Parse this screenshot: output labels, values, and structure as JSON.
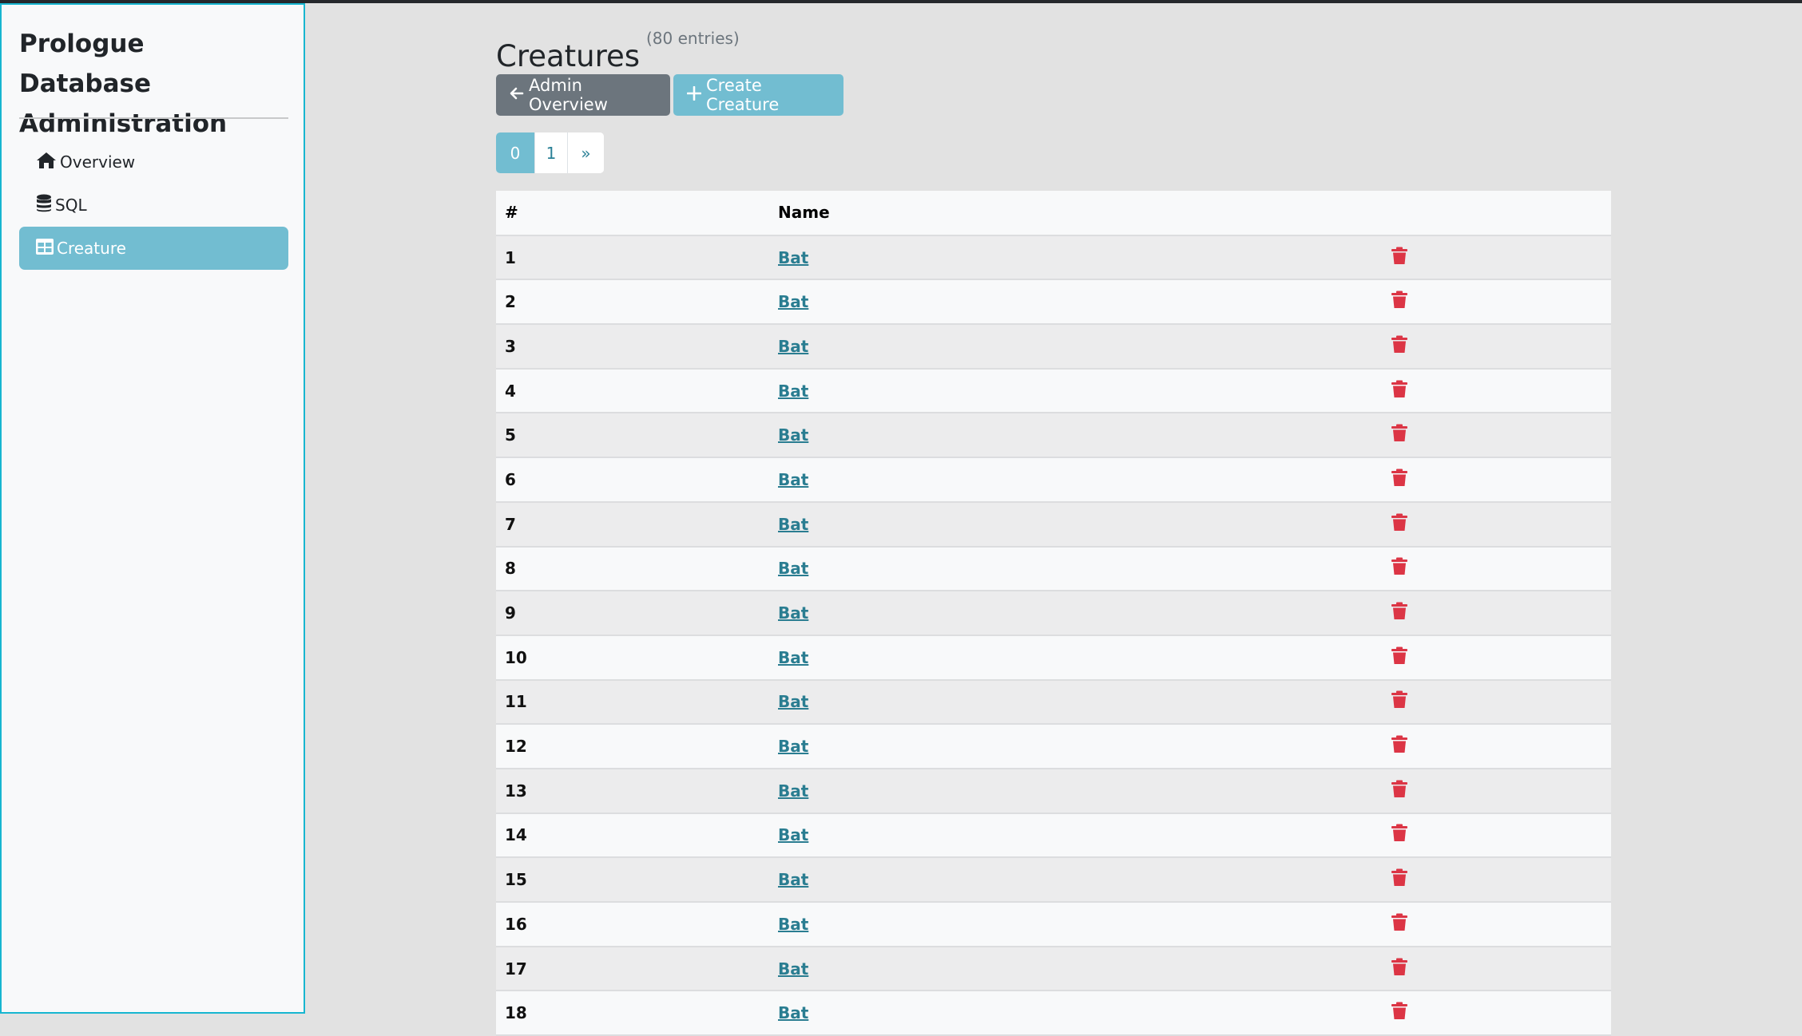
{
  "sidebar": {
    "brand": "Prologue Database Administration",
    "items": [
      {
        "label": "Overview",
        "icon": "home-icon",
        "active": false
      },
      {
        "label": "SQL",
        "icon": "database-icon",
        "active": false
      },
      {
        "label": "Creature",
        "icon": "table-icon",
        "active": true
      }
    ]
  },
  "header": {
    "title": "Creatures",
    "count": "(80 entries)"
  },
  "toolbar": {
    "back_label": "Admin Overview",
    "create_label": "Create Creature"
  },
  "pagination": {
    "pages": [
      "0",
      "1"
    ],
    "current": "0",
    "next": "»"
  },
  "table": {
    "columns": [
      "#",
      "Name",
      ""
    ],
    "rows": [
      {
        "id": "1",
        "name": "Bat"
      },
      {
        "id": "2",
        "name": "Bat"
      },
      {
        "id": "3",
        "name": "Bat"
      },
      {
        "id": "4",
        "name": "Bat"
      },
      {
        "id": "5",
        "name": "Bat"
      },
      {
        "id": "6",
        "name": "Bat"
      },
      {
        "id": "7",
        "name": "Bat"
      },
      {
        "id": "8",
        "name": "Bat"
      },
      {
        "id": "9",
        "name": "Bat"
      },
      {
        "id": "10",
        "name": "Bat"
      },
      {
        "id": "11",
        "name": "Bat"
      },
      {
        "id": "12",
        "name": "Bat"
      },
      {
        "id": "13",
        "name": "Bat"
      },
      {
        "id": "14",
        "name": "Bat"
      },
      {
        "id": "15",
        "name": "Bat"
      },
      {
        "id": "16",
        "name": "Bat"
      },
      {
        "id": "17",
        "name": "Bat"
      },
      {
        "id": "18",
        "name": "Bat"
      }
    ],
    "delete_icon": "trash-icon"
  },
  "colors": {
    "accent": "#72bdd1",
    "secondary": "#6c757d",
    "danger": "#dc3545",
    "link": "#2a7d91"
  }
}
